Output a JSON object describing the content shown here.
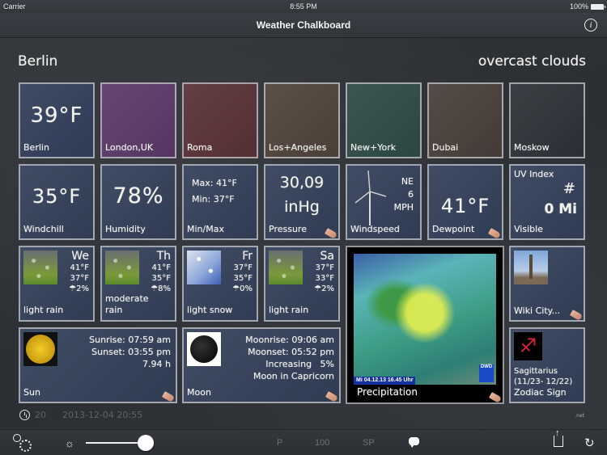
{
  "status_bar": {
    "carrier": "Carrier",
    "time": "8:55 PM",
    "battery": "100%"
  },
  "nav": {
    "title": "Weather Chalkboard",
    "info_icon": "i"
  },
  "header": {
    "city": "Berlin",
    "condition": "overcast clouds"
  },
  "cities": [
    {
      "name": "Berlin",
      "temp": "39°F"
    },
    {
      "name": "London,UK"
    },
    {
      "name": "Roma"
    },
    {
      "name": "Los+Angeles"
    },
    {
      "name": "New+York"
    },
    {
      "name": "Dubai"
    },
    {
      "name": "Moskow"
    }
  ],
  "details": {
    "windchill": {
      "value": "35°F",
      "label": "Windchill"
    },
    "humidity": {
      "value": "78%",
      "label": "Humidity"
    },
    "minmax": {
      "max": "Max: 41°F",
      "min": "Min: 37°F",
      "label": "Min/Max"
    },
    "pressure": {
      "value": "30,09",
      "unit": "inHg",
      "label": "Pressure"
    },
    "windspeed": {
      "direction": "NE",
      "speed": "6",
      "unit": "MPH",
      "label": "Windspeed"
    },
    "dewpoint": {
      "value": "41°F",
      "label": "Dewpoint"
    },
    "visibility": {
      "uv_label": "UV Index",
      "uv_value": "#",
      "value": "0 Mi",
      "label": "Visible"
    }
  },
  "forecast": [
    {
      "day": "We",
      "high": "41°F",
      "low": "37°F",
      "precip": "☂2%",
      "condition": "light rain",
      "icon": "rain"
    },
    {
      "day": "Th",
      "high": "41°F",
      "low": "35°F",
      "precip": "☂8%",
      "condition": "moderate rain",
      "icon": "rain"
    },
    {
      "day": "Fr",
      "high": "37°F",
      "low": "35°F",
      "precip": "☂0%",
      "condition": "light snow",
      "icon": "snow"
    },
    {
      "day": "Sa",
      "high": "37°F",
      "low": "33°F",
      "precip": "☂2%",
      "condition": "light rain",
      "icon": "rain"
    }
  ],
  "sun": {
    "sunrise": "Sunrise: 07:59 am",
    "sunset": "Sunset: 03:55 pm",
    "daylength": "7.94 h",
    "label": "Sun"
  },
  "moon": {
    "moonrise": "Moonrise: 09:06 am",
    "moonset": "Moonset: 05:52 pm",
    "phase": "Increasing   5%",
    "sign": "Moon in Capricorn",
    "label": "Moon"
  },
  "precipitation": {
    "stamp": "Mi 04.12.13 16.45 Uhr",
    "logo": "DWD",
    "label": "Precipitation"
  },
  "wiki": {
    "label": "Wiki City..."
  },
  "zodiac": {
    "symbol": "♐",
    "name": "Sagittarius",
    "range": "(11/23- 12/22)",
    "label": "Zodiac Sign"
  },
  "footer": {
    "count": "20",
    "updated": "2013-12-04 20:55",
    "net": ".net"
  },
  "toolbar": {
    "p": "P",
    "hundred": "100",
    "sp": "SP",
    "brightness": 0.85
  }
}
